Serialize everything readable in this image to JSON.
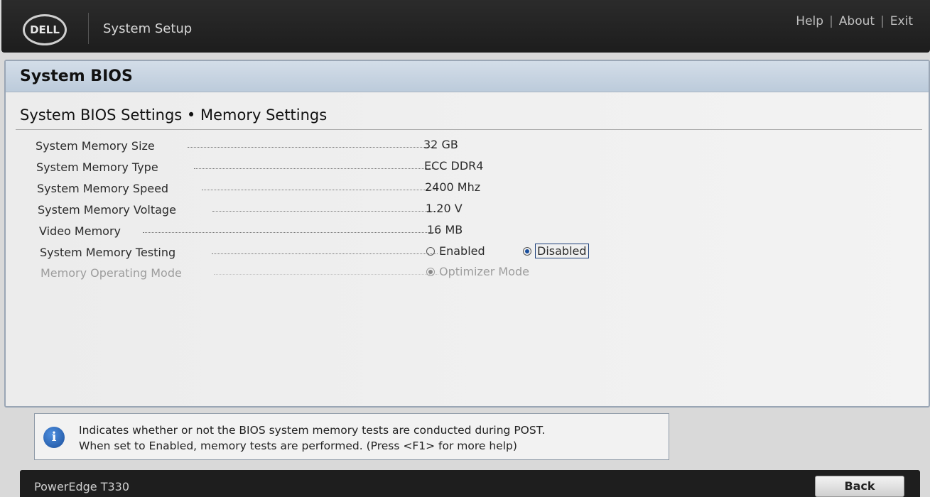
{
  "header": {
    "logo_text": "DELL",
    "app_title": "System Setup",
    "links": {
      "help": "Help",
      "about": "About",
      "exit": "Exit"
    },
    "separator": "|"
  },
  "panel": {
    "title": "System BIOS",
    "section_title": "System BIOS Settings • Memory Settings"
  },
  "settings": {
    "memory_size": {
      "label": "System Memory Size",
      "value": "32 GB"
    },
    "memory_type": {
      "label": "System Memory Type",
      "value": "ECC DDR4"
    },
    "memory_speed": {
      "label": "System Memory Speed",
      "value": "2400 Mhz"
    },
    "memory_voltage": {
      "label": "System Memory Voltage",
      "value": "1.20 V"
    },
    "video_memory": {
      "label": "Video Memory",
      "value": "16 MB"
    },
    "memory_testing": {
      "label": "System Memory Testing",
      "option_enabled": "Enabled",
      "option_disabled": "Disabled",
      "selected": "Disabled"
    },
    "operating_mode": {
      "label": "Memory Operating Mode",
      "option": "Optimizer Mode",
      "selected": "Optimizer Mode",
      "editable": false
    }
  },
  "help": {
    "line1": "Indicates whether or not the BIOS system memory tests are conducted during POST.",
    "line2": "When set to Enabled, memory tests are performed. (Press <F1> for more help)",
    "icon": "info-icon"
  },
  "footer": {
    "model": "PowerEdge T330",
    "back_label": "Back"
  },
  "colors": {
    "header_bg": "#1d1d1d",
    "panel_header": "#c6d3e1",
    "accent": "#1a4f9c"
  }
}
